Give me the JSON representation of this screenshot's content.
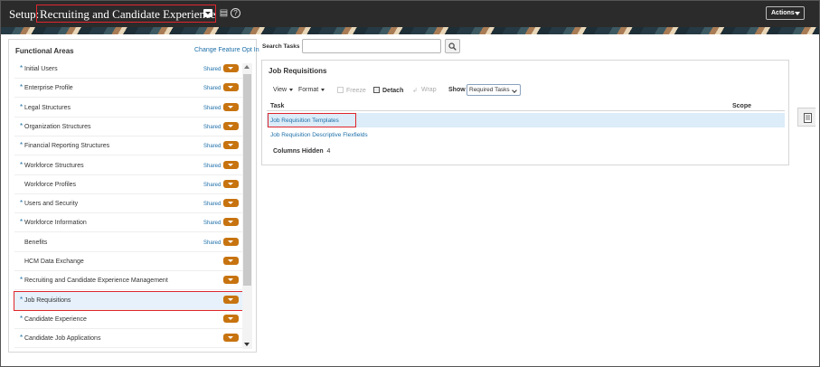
{
  "header": {
    "prefix": "Setup:",
    "title": "Recruiting and Candidate Experience",
    "actions_label": "Actions"
  },
  "left_panel": {
    "title": "Functional Areas",
    "change_link": "Change Feature Opt In",
    "items": [
      {
        "label": "Initial Users",
        "required": true,
        "shared": "Shared"
      },
      {
        "label": "Enterprise Profile",
        "required": true,
        "shared": "Shared"
      },
      {
        "label": "Legal Structures",
        "required": true,
        "shared": "Shared"
      },
      {
        "label": "Organization Structures",
        "required": true,
        "shared": "Shared"
      },
      {
        "label": "Financial Reporting Structures",
        "required": true,
        "shared": "Shared"
      },
      {
        "label": "Workforce Structures",
        "required": true,
        "shared": "Shared"
      },
      {
        "label": "Workforce Profiles",
        "required": false,
        "shared": "Shared"
      },
      {
        "label": "Users and Security",
        "required": true,
        "shared": "Shared"
      },
      {
        "label": "Workforce Information",
        "required": true,
        "shared": "Shared"
      },
      {
        "label": "Benefits",
        "required": false,
        "shared": "Shared"
      },
      {
        "label": "HCM Data Exchange",
        "required": false,
        "shared": ""
      },
      {
        "label": "Recruiting and Candidate Experience Management",
        "required": true,
        "shared": ""
      },
      {
        "label": "Job Requisitions",
        "required": true,
        "shared": "",
        "selected": true
      },
      {
        "label": "Candidate Experience",
        "required": true,
        "shared": ""
      },
      {
        "label": "Candidate Job Applications",
        "required": true,
        "shared": ""
      }
    ]
  },
  "search": {
    "label": "Search Tasks",
    "value": "",
    "placeholder": ""
  },
  "main": {
    "title": "Job Requisitions",
    "toolbar": {
      "view": "View",
      "format": "Format",
      "freeze": "Freeze",
      "detach": "Detach",
      "wrap": "Wrap",
      "show": "Show",
      "show_value": "Required Tasks"
    },
    "columns": {
      "task": "Task",
      "scope": "Scope"
    },
    "rows": [
      {
        "task": "Job Requisition Templates",
        "selected": true
      },
      {
        "task": "Job Requisition Descriptive Flexfields",
        "selected": false
      }
    ],
    "columns_hidden_label": "Columns Hidden",
    "columns_hidden_count": "4"
  },
  "icons": {
    "title_dropdown": "chevron-down-icon",
    "notes": "notes-icon",
    "help": "help-icon",
    "search": "search-icon",
    "side_panel": "document-list-icon"
  },
  "colors": {
    "header_bg": "#2b2b2b",
    "accent_orange": "#c7730f",
    "link_blue": "#1d6fa8",
    "selection_bg": "#dcecf8",
    "highlight_red": "#e0262d"
  }
}
